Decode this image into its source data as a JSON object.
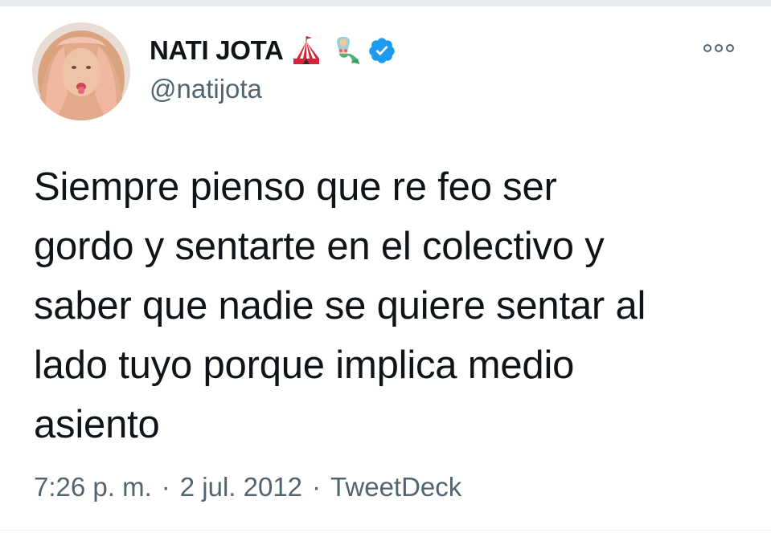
{
  "tweet": {
    "display_name": "NATI JOTA",
    "handle": "@natijota",
    "name_emojis": [
      "circus-tent-icon",
      "mermaid-icon"
    ],
    "verified": true,
    "text": "Siempre pienso que re feo ser\ngordo y sentarte en el colectivo y\nsaber que nadie se quiere sentar al\nlado tuyo porque implica medio\nasiento",
    "time": "7:26 p. m.",
    "separator": "·",
    "date": "2 jul. 2012",
    "source": "TweetDeck"
  },
  "colors": {
    "verified_blue": "#1d9bf0",
    "text_primary": "#0f1419",
    "text_secondary": "#536471"
  }
}
